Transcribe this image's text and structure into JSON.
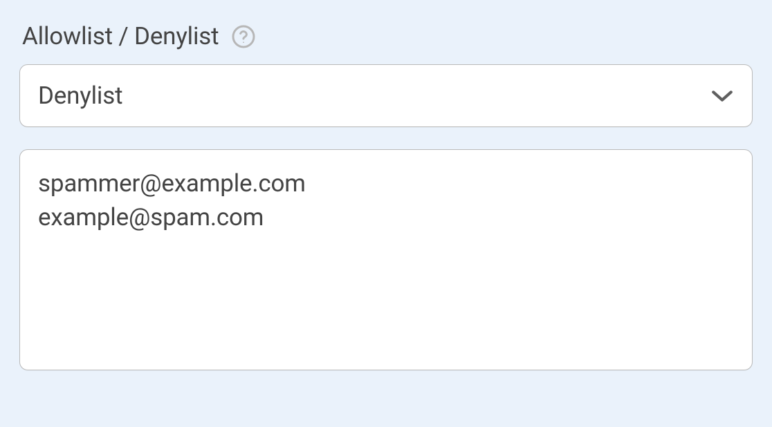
{
  "field": {
    "label": "Allowlist / Denylist",
    "select_value": "Denylist",
    "textarea_value": "spammer@example.com\nexample@spam.com"
  }
}
